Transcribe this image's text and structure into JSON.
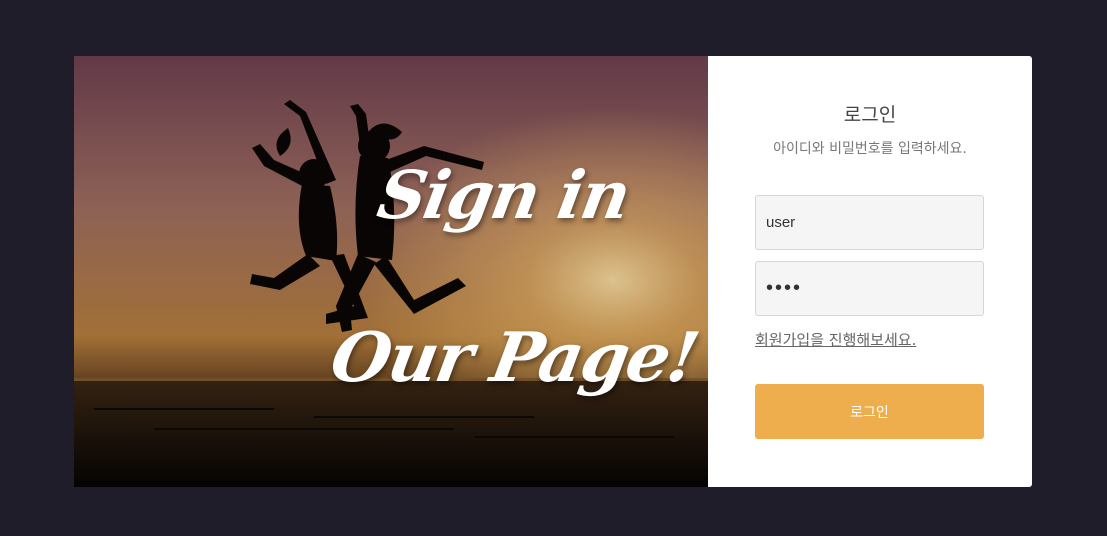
{
  "hero": {
    "headline_line1": "Sign in",
    "headline_line2": "Our Page!"
  },
  "login": {
    "title": "로그인",
    "subtitle": "아이디와 비밀번호를 입력하세요.",
    "username_value": "user",
    "password_value": "••••",
    "signup_link": "회원가입을 진행해보세요.",
    "submit_label": "로그인"
  },
  "colors": {
    "page_background": "#1f1d2a",
    "button_accent": "#efae4e",
    "panel_background": "#ffffff"
  }
}
